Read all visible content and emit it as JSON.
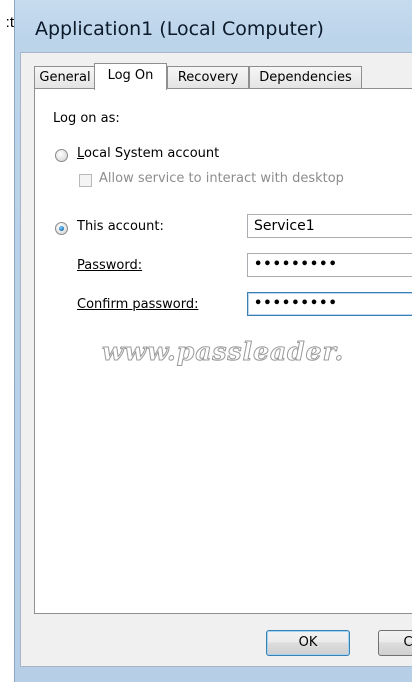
{
  "left_cut_text": "t:",
  "window": {
    "title": "Application1 (Local Computer)"
  },
  "tabs": [
    {
      "label": "General"
    },
    {
      "label": "Log On"
    },
    {
      "label": "Recovery"
    },
    {
      "label": "Dependencies"
    }
  ],
  "logon": {
    "section_label": "Log on as:",
    "local_system_label": "Local System account",
    "interact_desktop_label": "Allow service to interact with desktop",
    "this_account_label": "This account:",
    "this_account_value": "Service1",
    "password_label": "Password:",
    "password_value": "•••••••••",
    "confirm_password_label": "Confirm password:",
    "confirm_password_value": "•••••••••"
  },
  "watermark": "www.passleader.",
  "buttons": {
    "ok_label": "OK",
    "cancel_label": "C"
  }
}
